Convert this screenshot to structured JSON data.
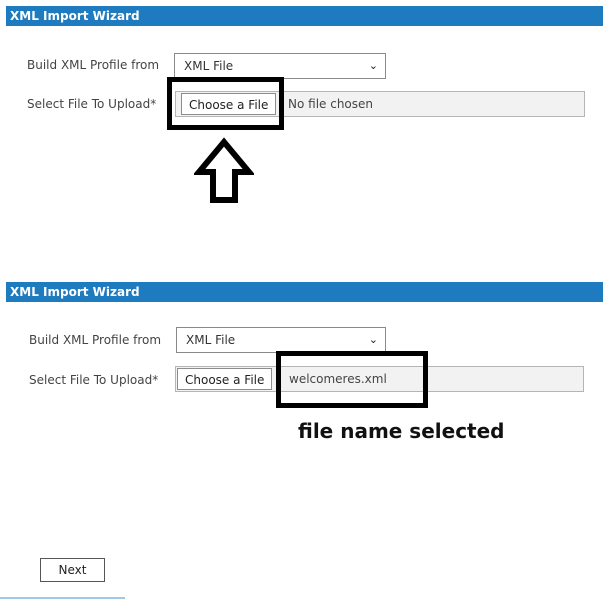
{
  "panel_top": {
    "title": "XML Import Wizard",
    "profile_label": "Build XML Profile from",
    "profile_value": "XML File",
    "file_label": "Select File To Upload*",
    "choose_button": "Choose a File",
    "file_status": "No file chosen"
  },
  "panel_bottom": {
    "title": "XML Import Wizard",
    "profile_label": "Build XML Profile from",
    "profile_value": "XML File",
    "file_label": "Select File To Upload*",
    "choose_button": "Choose a File",
    "file_status": "welcomeres.xml"
  },
  "annotation": {
    "selected_text": "file name selected"
  },
  "next_button": "Next",
  "icons": {
    "chevron": "chevron-down-icon",
    "arrow": "up-arrow-icon"
  },
  "colors": {
    "header": "#1f7bbf",
    "highlight": "#000000"
  }
}
